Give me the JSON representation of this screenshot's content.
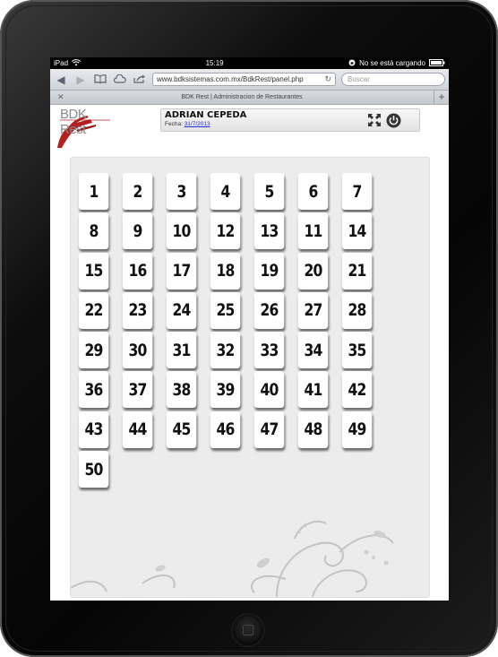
{
  "status_bar": {
    "carrier": "iPad",
    "time": "15:19",
    "loading": "No se está cargando"
  },
  "browser": {
    "url": "www.bdksistemas.com.mx/BdkRest/panel.php",
    "search_placeholder": "Buscar",
    "tab_title": "BDK Rest | Administracion de Restaurantes"
  },
  "header": {
    "logo_text": "BDK Rest",
    "user_name": "ADRIAN CEPEDA",
    "date_label": "Fecha:",
    "date_value": "31/7/2013"
  },
  "icons": {
    "expand": "expand-arrows-icon",
    "power": "power-icon"
  },
  "tables": [
    "1",
    "2",
    "3",
    "4",
    "5",
    "6",
    "7",
    "8",
    "9",
    "10",
    "12",
    "13",
    "11",
    "14",
    "15",
    "16",
    "17",
    "18",
    "19",
    "20",
    "21",
    "22",
    "23",
    "24",
    "25",
    "26",
    "27",
    "28",
    "29",
    "30",
    "31",
    "32",
    "33",
    "34",
    "35",
    "36",
    "37",
    "38",
    "39",
    "40",
    "41",
    "42",
    "43",
    "44",
    "45",
    "46",
    "47",
    "48",
    "49",
    "50"
  ],
  "colors": {
    "logo_red": "#b22020",
    "panel_bg": "#ececec"
  }
}
